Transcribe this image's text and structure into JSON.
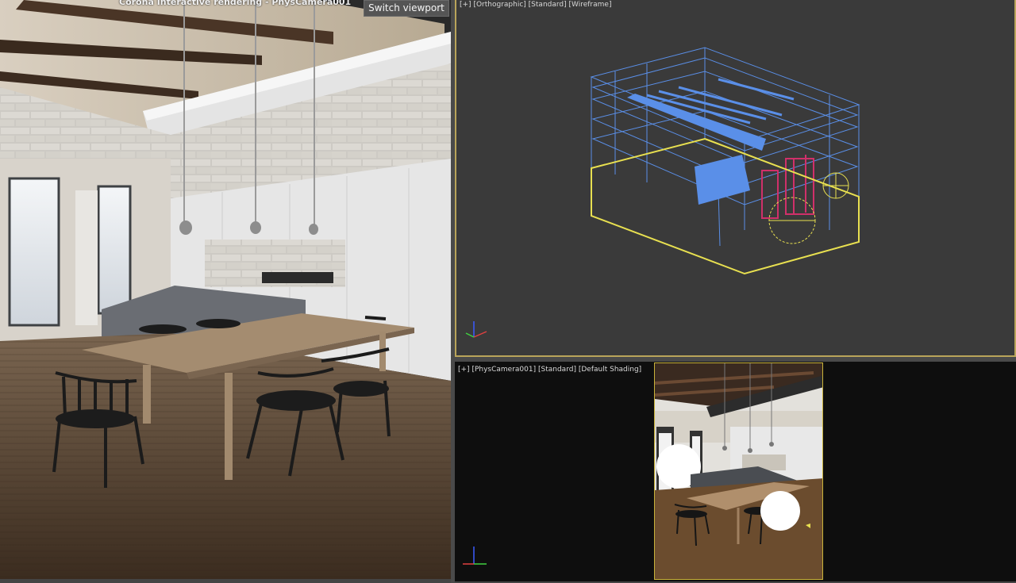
{
  "render_viewport": {
    "title": "Corona Interactive rendering - PhysCamera001",
    "switch_button_label": "Switch viewport"
  },
  "ortho_viewport": {
    "plus": "[+]",
    "view": "[Orthographic]",
    "style": "[Standard]",
    "shading": "[Wireframe]"
  },
  "camera_viewport": {
    "plus": "[+]",
    "view": "[PhysCamera001]",
    "style": "[Standard]",
    "shading": "[Default Shading]"
  },
  "colors": {
    "selection_yellow": "#e8e050",
    "wire_blue": "#5a8fe8",
    "frame_magenta": "#d0306a",
    "viewport_bg": "#3a3a3a"
  }
}
